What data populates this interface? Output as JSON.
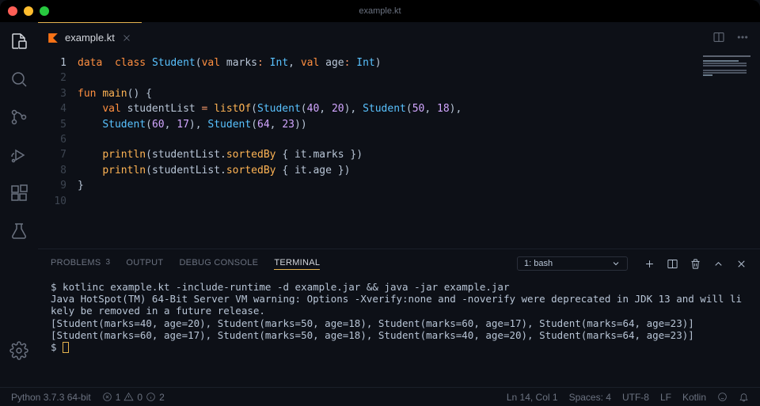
{
  "window": {
    "title": "example.kt"
  },
  "tab": {
    "filename": "example.kt"
  },
  "code": {
    "lines": [
      1,
      2,
      3,
      4,
      5,
      6,
      7,
      8,
      9,
      10
    ],
    "current_line": 1,
    "tokens": [
      [
        [
          "kw",
          "data"
        ],
        [
          "",
          "  "
        ],
        [
          "kw",
          "class"
        ],
        [
          "",
          " "
        ],
        [
          "ty",
          "Student"
        ],
        [
          "pr",
          "("
        ],
        [
          "kw",
          "val"
        ],
        [
          "",
          " "
        ],
        [
          "vr",
          "marks"
        ],
        [
          "op",
          ":"
        ],
        [
          "",
          " "
        ],
        [
          "ty",
          "Int"
        ],
        [
          "pr",
          ","
        ],
        [
          "",
          " "
        ],
        [
          "kw",
          "val"
        ],
        [
          "",
          " "
        ],
        [
          "vr",
          "age"
        ],
        [
          "op",
          ":"
        ],
        [
          "",
          " "
        ],
        [
          "ty",
          "Int"
        ],
        [
          "pr",
          ")"
        ]
      ],
      [],
      [
        [
          "kw",
          "fun"
        ],
        [
          "",
          " "
        ],
        [
          "fn",
          "main"
        ],
        [
          "pr",
          "()"
        ],
        [
          "",
          " "
        ],
        [
          "pr",
          "{"
        ]
      ],
      [
        [
          "",
          "    "
        ],
        [
          "kw",
          "val"
        ],
        [
          "",
          " "
        ],
        [
          "vr",
          "studentList"
        ],
        [
          "",
          " "
        ],
        [
          "op",
          "="
        ],
        [
          "",
          " "
        ],
        [
          "fn",
          "listOf"
        ],
        [
          "pr",
          "("
        ],
        [
          "ty",
          "Student"
        ],
        [
          "pr",
          "("
        ],
        [
          "nm",
          "40"
        ],
        [
          "pr",
          ","
        ],
        [
          "",
          " "
        ],
        [
          "nm",
          "20"
        ],
        [
          "pr",
          ")"
        ],
        [
          "pr",
          ","
        ],
        [
          "",
          " "
        ],
        [
          "ty",
          "Student"
        ],
        [
          "pr",
          "("
        ],
        [
          "nm",
          "50"
        ],
        [
          "pr",
          ","
        ],
        [
          "",
          " "
        ],
        [
          "nm",
          "18"
        ],
        [
          "pr",
          ")"
        ],
        [
          "pr",
          ","
        ]
      ],
      [
        [
          "",
          "    "
        ],
        [
          "ty",
          "Student"
        ],
        [
          "pr",
          "("
        ],
        [
          "nm",
          "60"
        ],
        [
          "pr",
          ","
        ],
        [
          "",
          " "
        ],
        [
          "nm",
          "17"
        ],
        [
          "pr",
          ")"
        ],
        [
          "pr",
          ","
        ],
        [
          "",
          " "
        ],
        [
          "ty",
          "Student"
        ],
        [
          "pr",
          "("
        ],
        [
          "nm",
          "64"
        ],
        [
          "pr",
          ","
        ],
        [
          "",
          " "
        ],
        [
          "nm",
          "23"
        ],
        [
          "pr",
          ")"
        ],
        [
          "pr",
          ")"
        ]
      ],
      [],
      [
        [
          "",
          "    "
        ],
        [
          "fn",
          "println"
        ],
        [
          "pr",
          "("
        ],
        [
          "vr",
          "studentList"
        ],
        [
          "pr",
          "."
        ],
        [
          "fn",
          "sortedBy"
        ],
        [
          "",
          " "
        ],
        [
          "pr",
          "{"
        ],
        [
          "",
          " "
        ],
        [
          "vr",
          "it"
        ],
        [
          "pr",
          "."
        ],
        [
          "vr",
          "marks"
        ],
        [
          "",
          " "
        ],
        [
          "pr",
          "}"
        ],
        [
          "pr",
          ")"
        ]
      ],
      [
        [
          "",
          "    "
        ],
        [
          "fn",
          "println"
        ],
        [
          "pr",
          "("
        ],
        [
          "vr",
          "studentList"
        ],
        [
          "pr",
          "."
        ],
        [
          "fn",
          "sortedBy"
        ],
        [
          "",
          " "
        ],
        [
          "pr",
          "{"
        ],
        [
          "",
          " "
        ],
        [
          "vr",
          "it"
        ],
        [
          "pr",
          "."
        ],
        [
          "vr",
          "age"
        ],
        [
          "",
          " "
        ],
        [
          "pr",
          "}"
        ],
        [
          "pr",
          ")"
        ]
      ],
      [
        [
          "pr",
          "}"
        ]
      ],
      []
    ]
  },
  "panel": {
    "tabs": {
      "problems": "PROBLEMS",
      "problems_count": "3",
      "output": "OUTPUT",
      "debug": "DEBUG CONSOLE",
      "terminal": "TERMINAL"
    },
    "terminal_select": "1: bash",
    "output_lines": [
      "$ kotlinc example.kt -include-runtime -d example.jar && java -jar example.jar",
      "Java HotSpot(TM) 64-Bit Server VM warning: Options -Xverify:none and -noverify were deprecated in JDK 13 and will likely be removed in a future release.",
      "[Student(marks=40, age=20), Student(marks=50, age=18), Student(marks=60, age=17), Student(marks=64, age=23)]",
      "[Student(marks=60, age=17), Student(marks=50, age=18), Student(marks=40, age=20), Student(marks=64, age=23)]",
      "$ "
    ]
  },
  "status": {
    "python": "Python 3.7.3 64-bit",
    "err": "1",
    "warn": "0",
    "info": "2",
    "lncol": "Ln 14, Col 1",
    "spaces": "Spaces: 4",
    "enc": "UTF-8",
    "eol": "LF",
    "lang": "Kotlin"
  }
}
